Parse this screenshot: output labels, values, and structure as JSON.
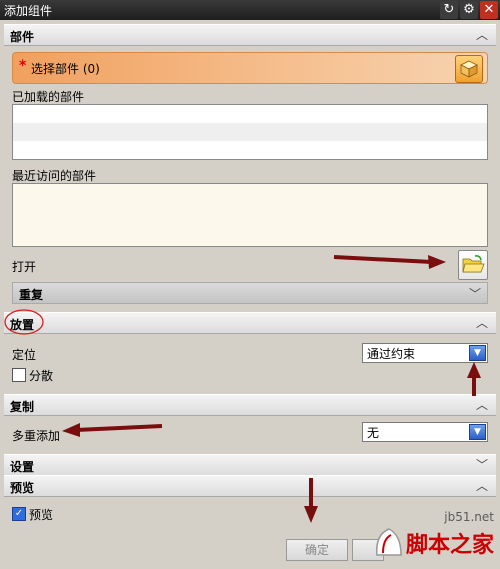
{
  "window": {
    "title": "添加组件",
    "controls": [
      "refresh-icon",
      "gear-icon",
      "close-icon"
    ]
  },
  "sections": {
    "parts": {
      "header": "部件",
      "select_label": "选择部件 (0)",
      "loaded_label": "已加载的部件",
      "recent_label": "最近访问的部件",
      "open_label": "打开",
      "duplicate_label": "重复"
    },
    "placement": {
      "header": "放置",
      "position_label": "定位",
      "position_value": "通过约束",
      "scatter_label": "分散",
      "scatter_checked": false
    },
    "copy": {
      "header": "复制",
      "multi_add_label": "多重添加",
      "multi_add_value": "无"
    },
    "settings": {
      "header": "设置"
    },
    "preview": {
      "header": "预览",
      "preview_label": "预览",
      "preview_checked": true
    }
  },
  "footer": {
    "ok_label": "确定"
  },
  "watermark": {
    "url": "jb51.net",
    "text": "脚本之家"
  },
  "colors": {
    "selection_bar": "#f1a05e",
    "annotation_arrow": "#7a0e0e",
    "annotation_circle": "#d42020",
    "combo_button": "#2c5fc8",
    "watermark": "#cc0000"
  }
}
